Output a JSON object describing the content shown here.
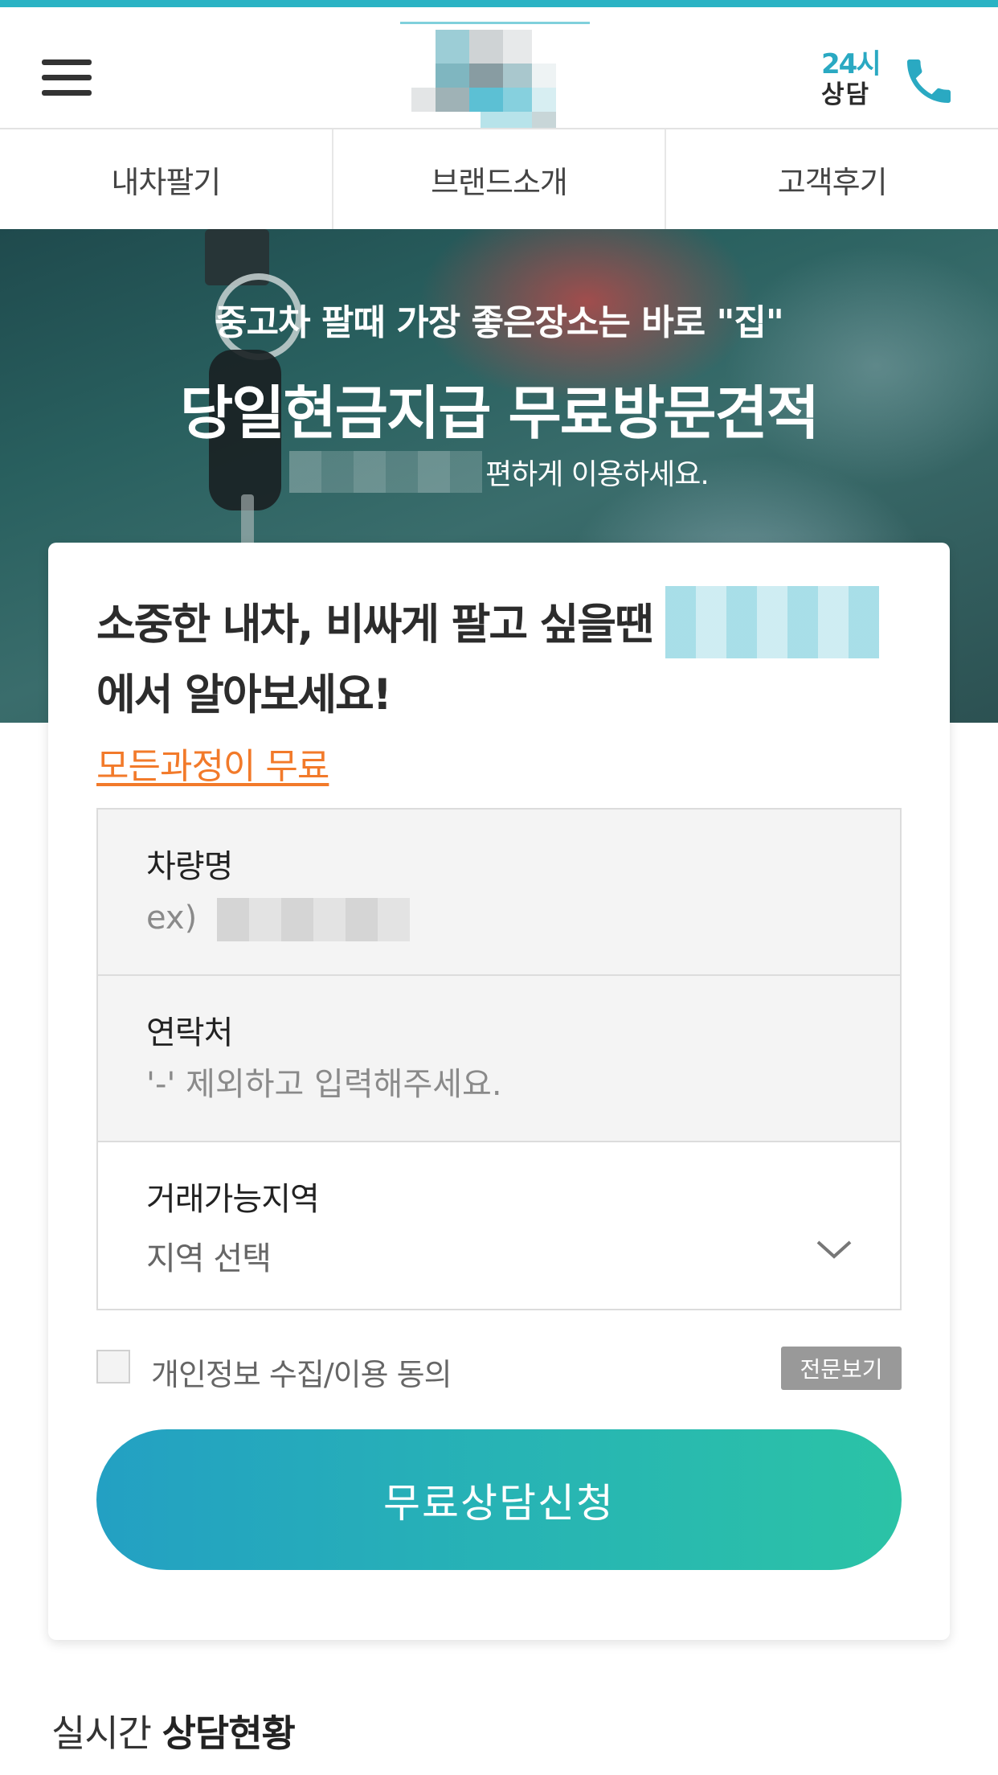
{
  "header": {
    "consult_top": "24시",
    "consult_bottom": "상담",
    "accent_color": "#2ab3c4"
  },
  "icons": {
    "menu": "hamburger-menu-icon",
    "phone": "phone-icon",
    "dropdown": "chevron-down-icon"
  },
  "nav": {
    "tabs": [
      {
        "label": "내차팔기"
      },
      {
        "label": "브랜드소개"
      },
      {
        "label": "고객후기"
      }
    ]
  },
  "hero": {
    "line1": "중고차 팔때 가장 좋은장소는 바로 \"집\"",
    "line2": "당일현금지급 무료방문견적",
    "line3_suffix": "편하게 이용하세요."
  },
  "form": {
    "heading_part1": "소중한 내차, 비싸게 팔고 싶을땐",
    "heading_part2": "에서 알아보세요!",
    "free_note": "모든과정이 무료",
    "fields": {
      "car_name": {
        "label": "차량명",
        "placeholder_prefix": "ex)"
      },
      "contact": {
        "label": "연락처",
        "placeholder": "'-' 제외하고 입력해주세요."
      },
      "region": {
        "label": "거래가능지역",
        "selected": "지역 선택"
      }
    },
    "agree_text": "개인정보 수집/이용 동의",
    "view_full": "전문보기",
    "submit_label": "무료상담신청",
    "submit_gradient": [
      "#23a0c3",
      "#2bc3a6"
    ],
    "free_note_color": "#f27a2a"
  },
  "live": {
    "prefix": "실시간",
    "bold": "상담현황"
  }
}
